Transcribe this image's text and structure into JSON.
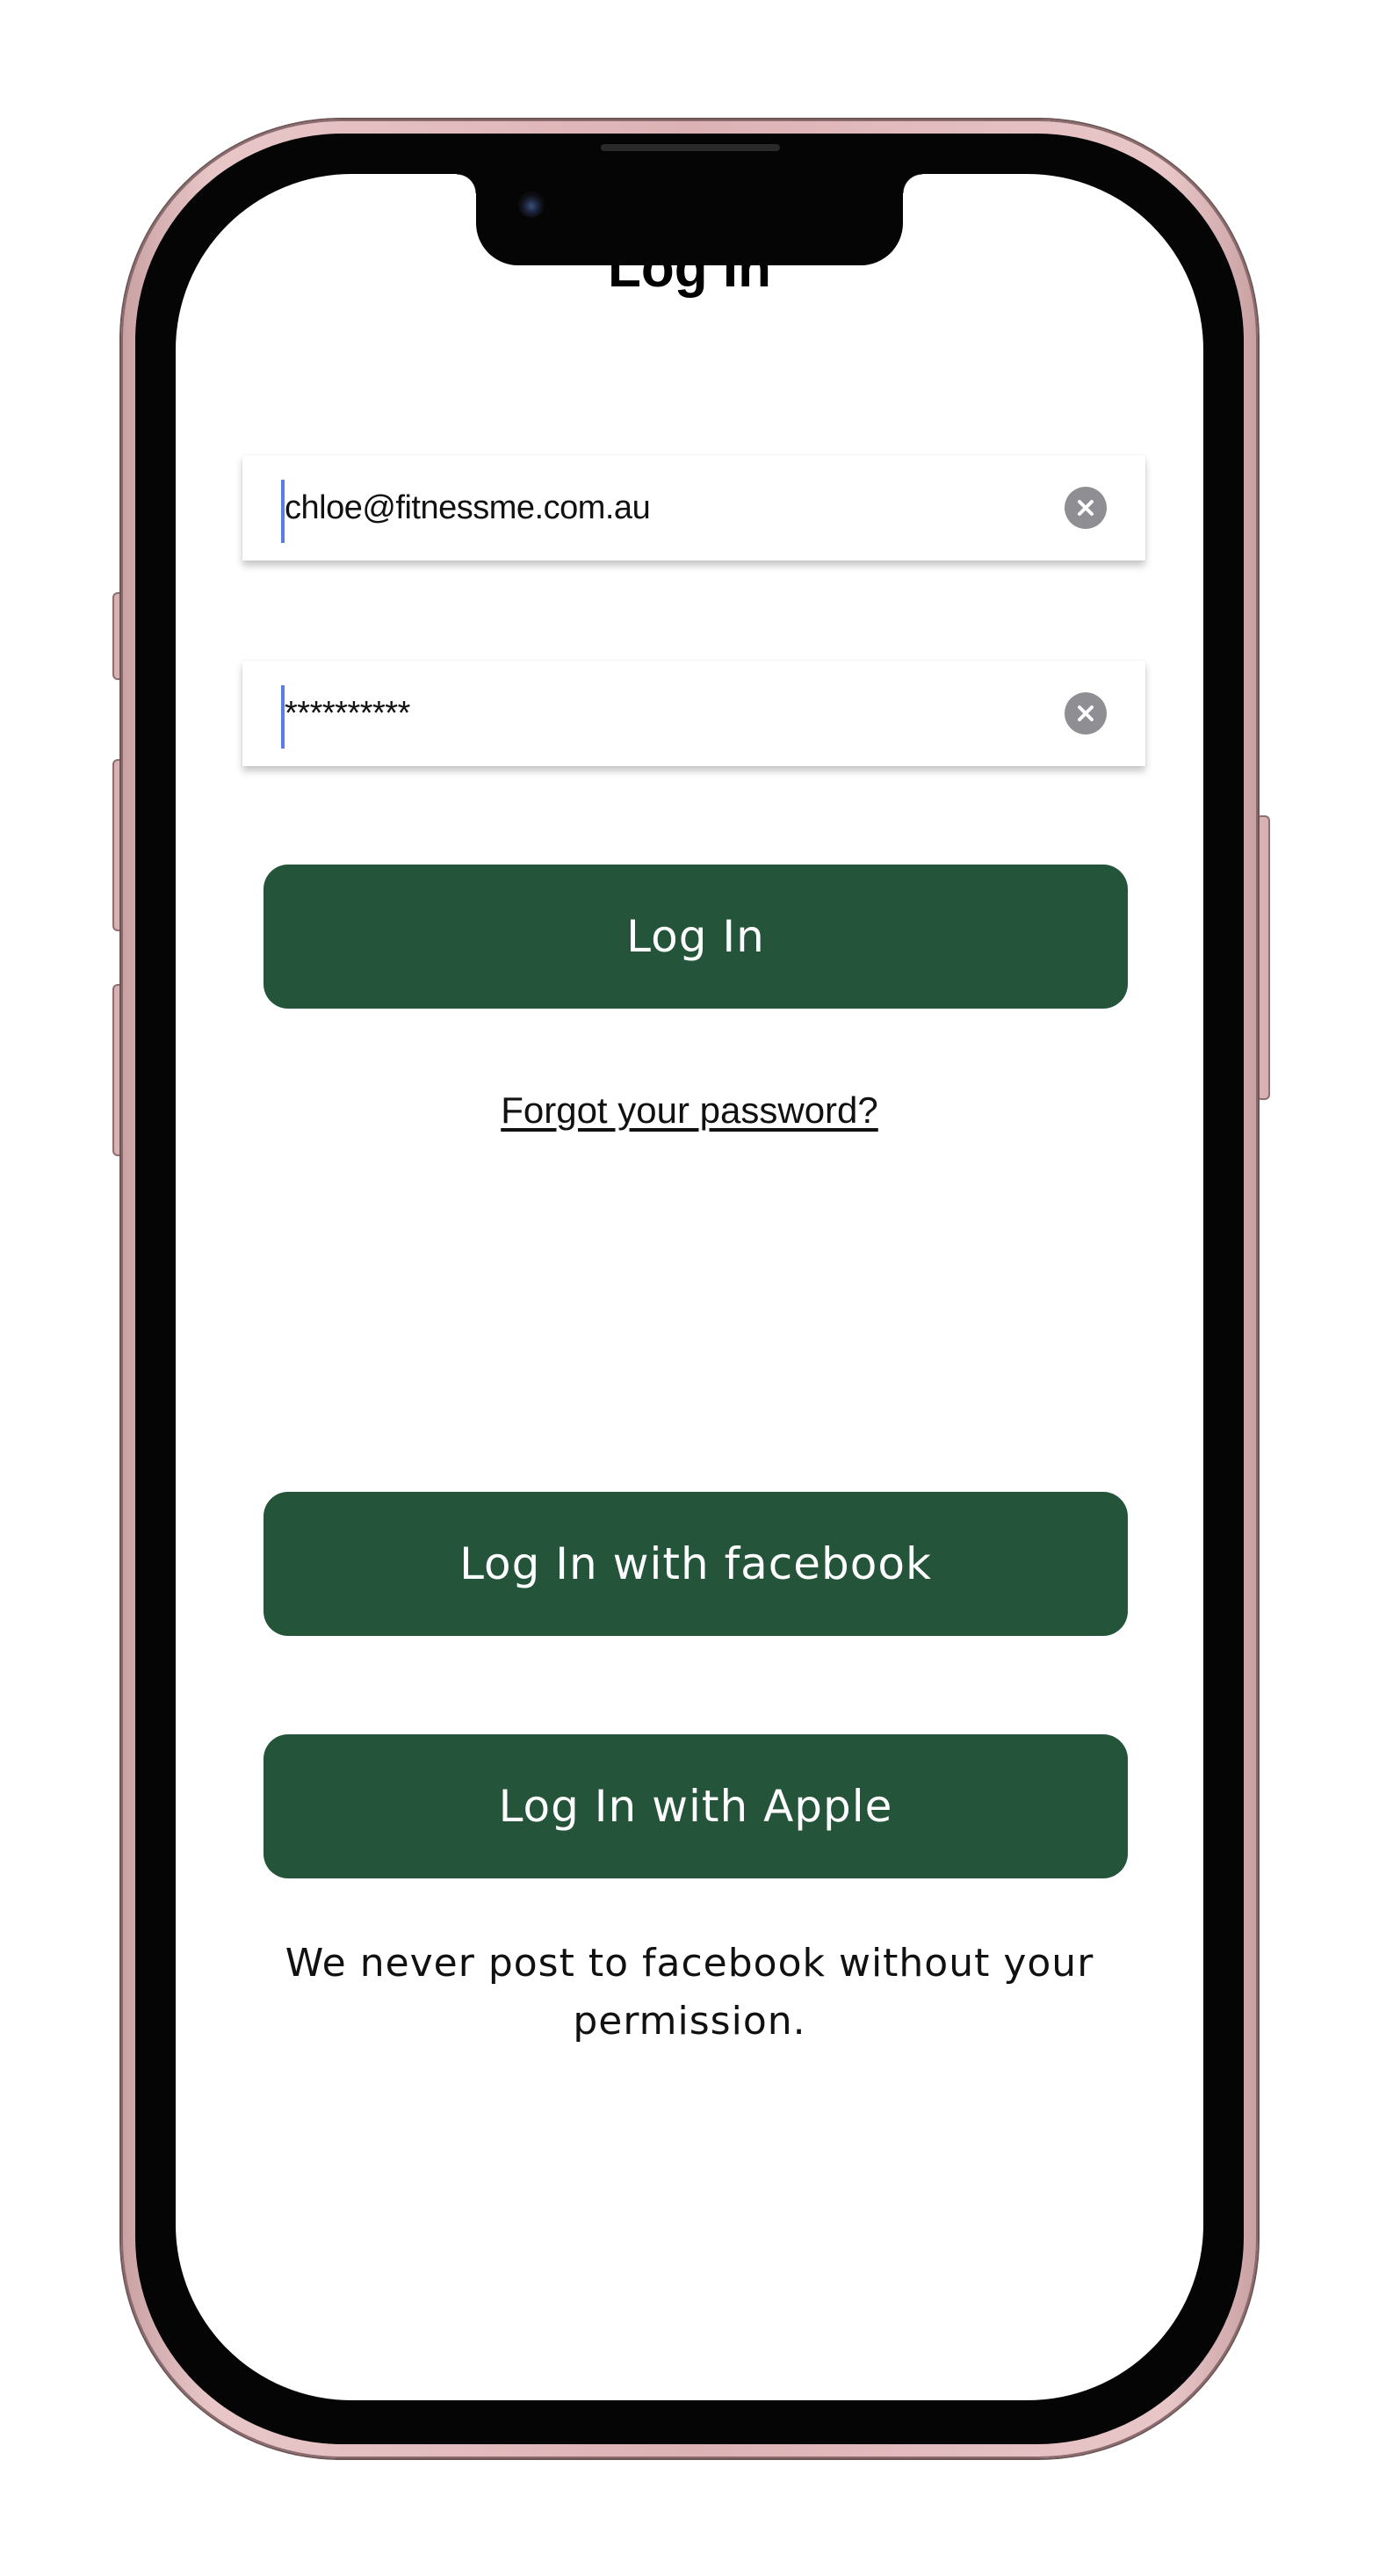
{
  "screen": {
    "title": "Log In"
  },
  "form": {
    "email_value": "chloe@fitnessme.com.au",
    "password_value": "**********",
    "clear_icon": "clear-circle-icon"
  },
  "buttons": {
    "login_label": "Log In",
    "facebook_label": "Log In with facebook",
    "apple_label": "Log In with Apple"
  },
  "links": {
    "forgot_password": "Forgot your password?"
  },
  "footer": {
    "disclaimer": "We never post to facebook without your permission."
  },
  "colors": {
    "primary_button": "#24553B",
    "caret": "#5A7BEA",
    "clear_icon_bg": "#8E8E93"
  }
}
